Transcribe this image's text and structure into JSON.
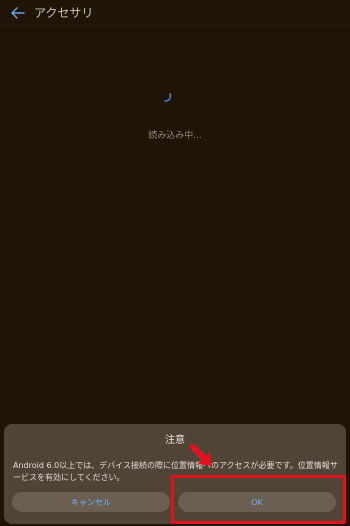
{
  "app_bar": {
    "back_icon": "arrow-left-icon",
    "title": "アクセサリ"
  },
  "loading": {
    "text": "読み込み中..."
  },
  "dialog": {
    "title": "注意",
    "message": "Android 6.0以上では、デバイス接続の際に位置情報へのアクセスが必要です。位置情報サービスを有効にしてください。",
    "cancel_label": "キャンセル",
    "ok_label": "OK"
  },
  "colors": {
    "background": "#1f1406",
    "dialog": "#4f4436",
    "button": "#6a5f51",
    "button_text": "#72b4ff",
    "highlight": "#e3111c"
  }
}
